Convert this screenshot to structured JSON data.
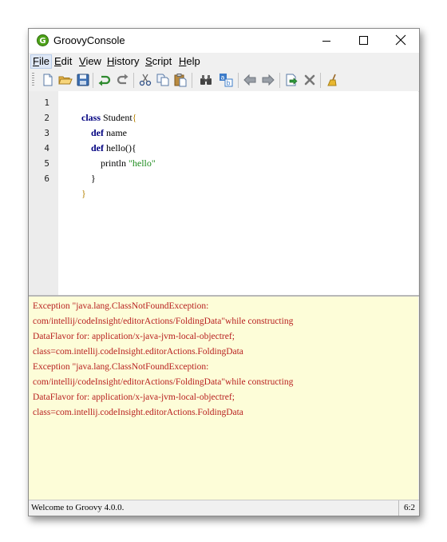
{
  "window": {
    "title": "GroovyConsole",
    "app_icon_letter": "G"
  },
  "menu": [
    {
      "first": "F",
      "rest": "ile",
      "active": true
    },
    {
      "first": "E",
      "rest": "dit"
    },
    {
      "first": "V",
      "rest": "iew"
    },
    {
      "first": "H",
      "rest": "istory"
    },
    {
      "first": "S",
      "rest": "cript"
    },
    {
      "first": "H",
      "rest": "elp"
    }
  ],
  "toolbar": {
    "buttons": [
      "new-file-icon",
      "open-folder-icon",
      "save-icon",
      "undo-icon",
      "redo-icon",
      "cut-icon",
      "copy-icon",
      "paste-icon",
      "find-icon",
      "replace-icon",
      "previous-history-icon",
      "next-history-icon",
      "run-script-icon",
      "interrupt-icon",
      "clear-output-icon"
    ]
  },
  "editor": {
    "line_numbers": [
      "1",
      "2",
      "3",
      "4",
      "5",
      "6"
    ],
    "lines": [
      [
        {
          "t": "class",
          "c": "kw"
        },
        {
          "t": " Student",
          "c": "id"
        },
        {
          "t": "{",
          "c": "brace"
        }
      ],
      [
        {
          "t": "    def",
          "c": "kw"
        },
        {
          "t": " name",
          "c": "id"
        }
      ],
      [
        {
          "t": "    def",
          "c": "kw"
        },
        {
          "t": " hello(){",
          "c": "id"
        }
      ],
      [
        {
          "t": "        println ",
          "c": "id"
        },
        {
          "t": "\"hello\"",
          "c": "str"
        }
      ],
      [
        {
          "t": "    }",
          "c": "id"
        }
      ],
      [
        {
          "t": "}",
          "c": "brace"
        }
      ]
    ]
  },
  "output": {
    "lines": [
      "Exception \"java.lang.ClassNotFoundException:",
      "com/intellij/codeInsight/editorActions/FoldingData\"while constructing",
      "DataFlavor for: application/x-java-jvm-local-objectref;",
      "class=com.intellij.codeInsight.editorActions.FoldingData",
      "Exception \"java.lang.ClassNotFoundException:",
      "com/intellij/codeInsight/editorActions/FoldingData\"while constructing",
      "DataFlavor for: application/x-java-jvm-local-objectref;",
      "class=com.intellij.codeInsight.editorActions.FoldingData"
    ]
  },
  "status": {
    "message": "Welcome to Groovy 4.0.0.",
    "position": "6:2"
  }
}
